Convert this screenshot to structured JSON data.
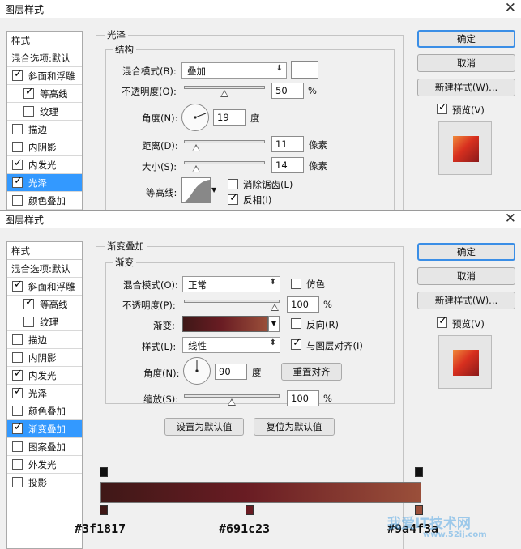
{
  "colors": {
    "accent": "#3399ff",
    "grad_start": "#3f1817",
    "grad_mid": "#691c23",
    "grad_end": "#9a4f3a"
  },
  "dialog1": {
    "title": "图层样式",
    "sidebar": {
      "header": "样式",
      "items": [
        {
          "label": "混合选项:默认"
        },
        {
          "label": "斜面和浮雕",
          "checked": true
        },
        {
          "label": "等高线",
          "checked": true
        },
        {
          "label": "纹理",
          "checked": false
        },
        {
          "label": "描边",
          "checked": false
        },
        {
          "label": "内阴影",
          "checked": false
        },
        {
          "label": "内发光",
          "checked": true
        },
        {
          "label": "光泽",
          "checked": true,
          "selected": true
        },
        {
          "label": "颜色叠加",
          "checked": false
        }
      ]
    },
    "panel": {
      "group_title": "光泽",
      "sub_title": "结构",
      "blend_label": "混合模式(B):",
      "blend_value": "叠加",
      "opacity_label": "不透明度(O):",
      "opacity_value": "50",
      "opacity_unit": "%",
      "angle_label": "角度(N):",
      "angle_value": "19",
      "angle_unit": "度",
      "distance_label": "距离(D):",
      "distance_value": "11",
      "distance_unit": "像素",
      "size_label": "大小(S):",
      "size_value": "14",
      "size_unit": "像素",
      "contour_label": "等高线:",
      "antialias_label": "消除锯齿(L)",
      "invert_label": "反相(I)",
      "opacity_level": 0.5,
      "distance_level": 0.1,
      "size_level": 0.1
    },
    "buttons": {
      "ok": "确定",
      "cancel": "取消",
      "new_style": "新建样式(W)...",
      "preview": "预览(V)"
    }
  },
  "dialog2": {
    "title": "图层样式",
    "sidebar": {
      "header": "样式",
      "items": [
        {
          "label": "混合选项:默认"
        },
        {
          "label": "斜面和浮雕",
          "checked": true
        },
        {
          "label": "等高线",
          "checked": true
        },
        {
          "label": "纹理",
          "checked": false
        },
        {
          "label": "描边",
          "checked": false
        },
        {
          "label": "内阴影",
          "checked": false
        },
        {
          "label": "内发光",
          "checked": true
        },
        {
          "label": "光泽",
          "checked": true
        },
        {
          "label": "颜色叠加",
          "checked": false
        },
        {
          "label": "渐变叠加",
          "checked": true,
          "selected": true
        },
        {
          "label": "图案叠加",
          "checked": false
        },
        {
          "label": "外发光",
          "checked": false
        },
        {
          "label": "投影",
          "checked": false
        }
      ]
    },
    "panel": {
      "group_title": "渐变叠加",
      "sub_title": "渐变",
      "blend_label": "混合模式(O):",
      "blend_value": "正常",
      "dither_label": "仿色",
      "opacity_label": "不透明度(P):",
      "opacity_value": "100",
      "opacity_unit": "%",
      "gradient_label": "渐变:",
      "reverse_label": "反向(R)",
      "style_label": "样式(L):",
      "style_value": "线性",
      "align_label": "与图层对齐(I)",
      "angle_label": "角度(N):",
      "angle_value": "90",
      "angle_unit": "度",
      "reset_align": "重置对齐",
      "scale_label": "缩放(S):",
      "scale_value": "100",
      "scale_unit": "%",
      "set_default": "设置为默认值",
      "reset_default": "复位为默认值",
      "opacity_level": 1.0,
      "scale_level": 0.5
    },
    "buttons": {
      "ok": "确定",
      "cancel": "取消",
      "new_style": "新建样式(W)...",
      "preview": "预览(V)"
    },
    "gradient_stops": [
      "#3f1817",
      "#691c23",
      "#9a4f3a"
    ]
  },
  "watermark": {
    "text1": "我爱IT技术网",
    "text2": "www.52ij.com"
  }
}
